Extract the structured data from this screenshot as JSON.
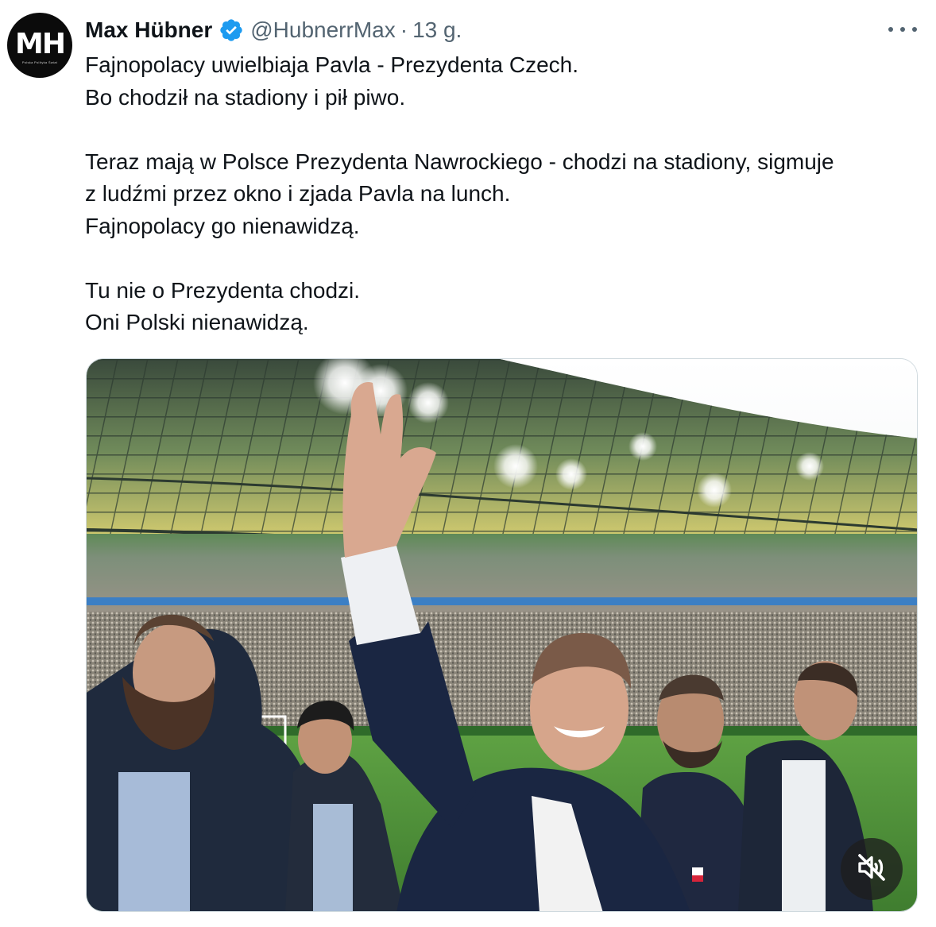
{
  "author": {
    "avatar_initials": "MH",
    "avatar_subtitle": "Polska Polityka Świat",
    "display_name": "Max Hübner",
    "handle": "@HubnerrMax",
    "separator": "·",
    "time": "13 g."
  },
  "tweet": {
    "lines": [
      "Fajnopolacy uwielbiaja Pavla - Prezydenta Czech.",
      "Bo chodził na stadiony i pił piwo.",
      "",
      "Teraz mają w Polsce Prezydenta Nawrockiego - chodzi na stadiony, sigmuje",
      "z ludźmi przez okno i zjada Pavla na lunch.",
      "Fajnopolacy go nienawidzą.",
      "",
      "Tu nie o Prezydenta chodzi.",
      "Oni Polski nienawidzą."
    ]
  },
  "icons": {
    "verified": "verified-badge-icon",
    "more": "more-options-icon",
    "mute": "muted-speaker-icon"
  },
  "colors": {
    "verified_blue": "#1d9bf0",
    "secondary_text": "#536471",
    "primary_text": "#0f1419"
  }
}
